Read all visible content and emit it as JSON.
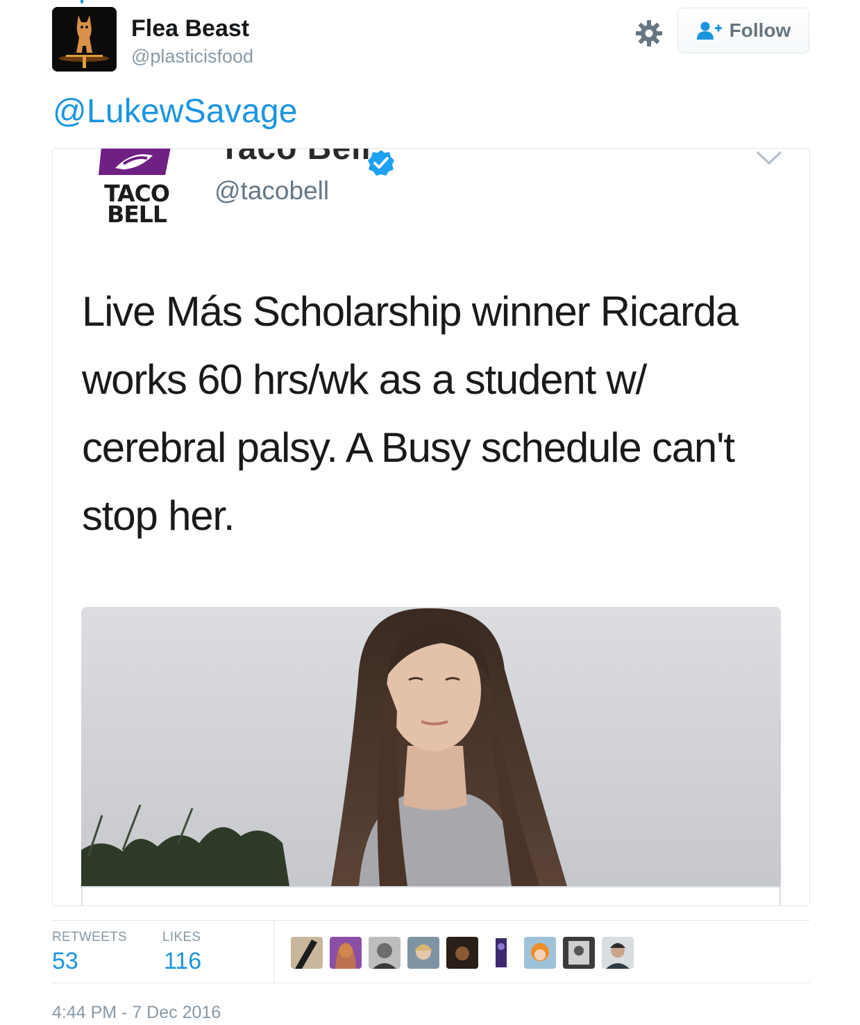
{
  "tweet": {
    "author": {
      "display_name": "Flea Beast",
      "screen_name": "@plasticisfood"
    },
    "follow_label": "Follow",
    "reply_mention": "@LukewSavage",
    "stats": {
      "retweets_label": "RETWEETS",
      "retweets": "53",
      "likes_label": "LIKES",
      "likes": "116"
    },
    "timestamp": "4:44 PM - 7 Dec 2016"
  },
  "embedded": {
    "logo_text_line1": "TACO",
    "logo_text_line2": "BELL",
    "name": "Taco Bell",
    "handle": "@tacobell",
    "body": "Live Más Scholarship winner Ricarda works 60 hrs/wk as a student w/ cerebral palsy. A Busy schedule can't stop her."
  },
  "colors": {
    "link_blue": "#1b95e0",
    "muted_gray": "#8899a6",
    "taco_bell_purple": "#702082"
  },
  "icons": [
    "gear-icon",
    "follow-user-icon",
    "verified-badge-icon",
    "chevron-down-icon"
  ]
}
